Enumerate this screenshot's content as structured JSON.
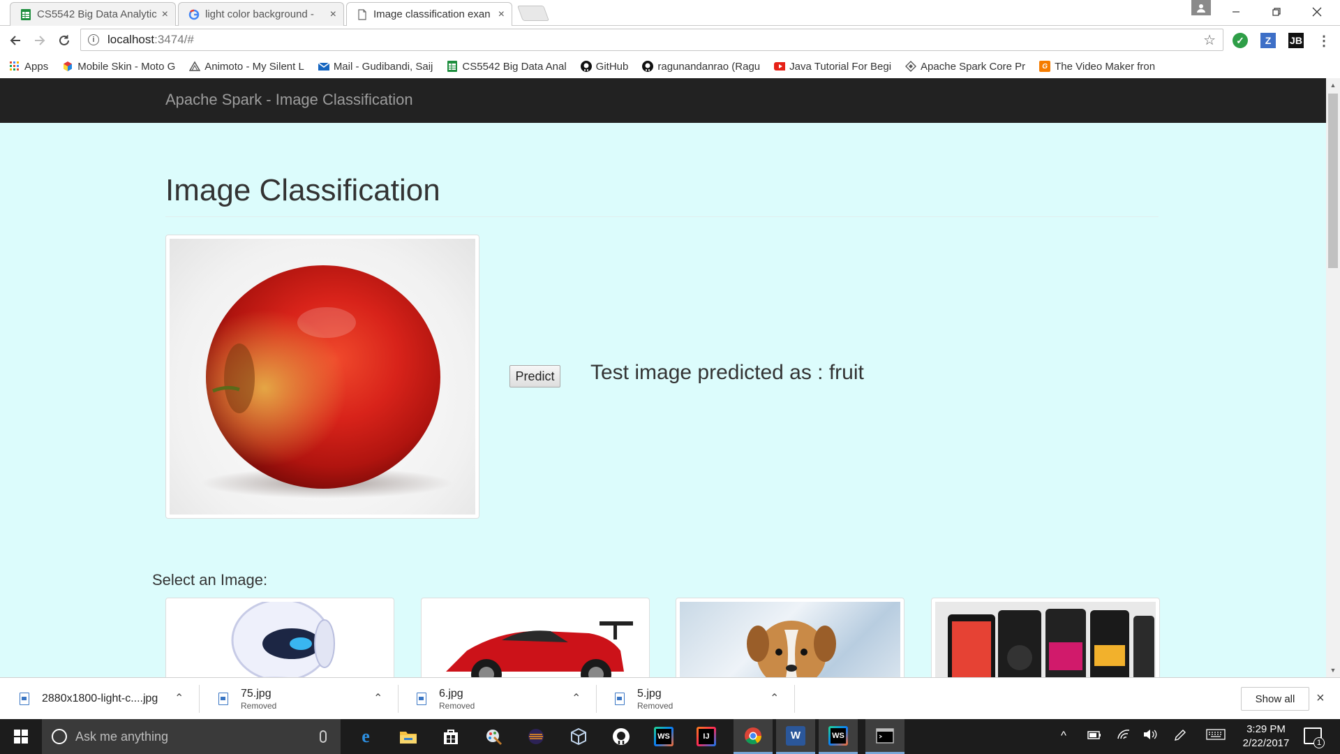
{
  "browser": {
    "tabs": [
      {
        "label": "CS5542 Big Data Analytic"
      },
      {
        "label": "light color background -"
      },
      {
        "label": "Image classification exan"
      }
    ],
    "close_glyph": "×",
    "url_host": "localhost",
    "url_path": ":3474/#",
    "bookmarks": [
      {
        "label": "Apps"
      },
      {
        "label": "Mobile Skin - Moto G"
      },
      {
        "label": "Animoto - My Silent L"
      },
      {
        "label": "Mail - Gudibandi, Saij"
      },
      {
        "label": "CS5542 Big Data Anal"
      },
      {
        "label": "GitHub"
      },
      {
        "label": "ragunandanrao (Ragu"
      },
      {
        "label": "Java Tutorial For Begi"
      },
      {
        "label": "Apache Spark Core Pr"
      },
      {
        "label": "The Video Maker fron"
      }
    ]
  },
  "page": {
    "brand": "Apache Spark - Image Classification",
    "title": "Image Classification",
    "predict_label": "Predict",
    "result": "Test image predicted as : fruit",
    "select_label": "Select an Image:"
  },
  "downloads": {
    "items": [
      {
        "name": "2880x1800-light-c....jpg",
        "status": ""
      },
      {
        "name": "75.jpg",
        "status": "Removed"
      },
      {
        "name": "6.jpg",
        "status": "Removed"
      },
      {
        "name": "5.jpg",
        "status": "Removed"
      }
    ],
    "show_all": "Show all"
  },
  "taskbar": {
    "search_placeholder": "Ask me anything",
    "time": "3:29 PM",
    "date": "2/22/2017",
    "notification_count": "1"
  },
  "colors": {
    "page_background": "#dcfcfc",
    "navbar": "#222222",
    "taskbar": "#1c1c1c"
  }
}
